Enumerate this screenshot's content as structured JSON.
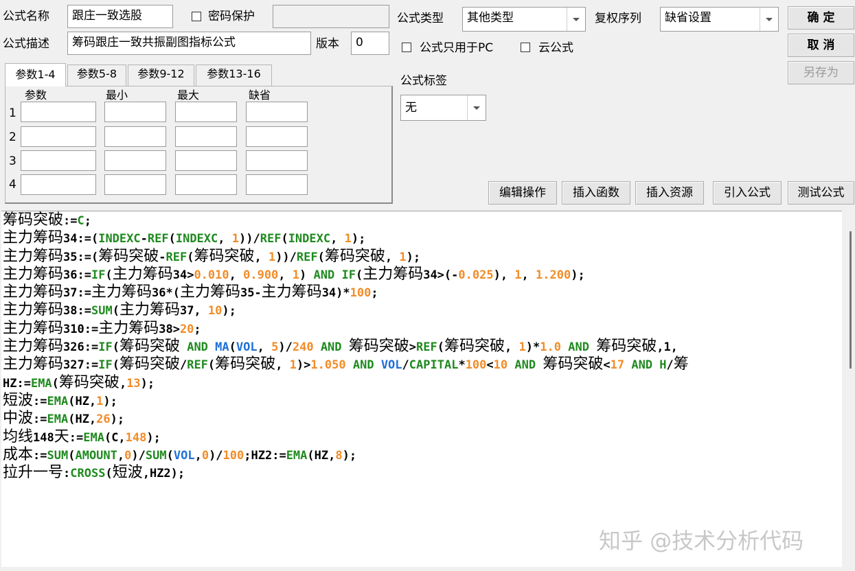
{
  "form": {
    "name_label": "公式名称",
    "name_value": "跟庄一致选股",
    "password_label": "密码保护",
    "password_value": "",
    "desc_label": "公式描述",
    "desc_value": "筹码跟庄一致共振副图指标公式",
    "version_label": "版本",
    "version_value": "0",
    "type_label": "公式类型",
    "type_value": "其他类型",
    "rights_label": "复权序列",
    "rights_value": "缺省设置",
    "pc_only_label": "公式只用于PC",
    "cloud_label": "云公式",
    "tag_label": "公式标签",
    "tag_value": "无"
  },
  "buttons": {
    "ok": "确 定",
    "cancel": "取 消",
    "save_as": "另存为",
    "edit": "编辑操作",
    "insert_func": "插入函数",
    "insert_res": "插入资源",
    "import": "引入公式",
    "test": "测试公式"
  },
  "tabs": [
    "参数1-4",
    "参数5-8",
    "参数9-12",
    "参数13-16"
  ],
  "params": {
    "headers": [
      "参数",
      "最小",
      "最大",
      "缺省"
    ],
    "rows": [
      "1",
      "2",
      "3",
      "4"
    ]
  },
  "code_lines": [
    [
      {
        "c": "t",
        "s": "筹码突破"
      },
      {
        "c": "t",
        "s": ":="
      },
      {
        "c": "k",
        "s": "C"
      },
      {
        "c": "t",
        "s": ";"
      }
    ],
    [
      {
        "c": "t",
        "s": "主力筹码34:=("
      },
      {
        "c": "k",
        "s": "INDEXC"
      },
      {
        "c": "t",
        "s": "-"
      },
      {
        "c": "k",
        "s": "REF"
      },
      {
        "c": "t",
        "s": "("
      },
      {
        "c": "k",
        "s": "INDEXC"
      },
      {
        "c": "t",
        "s": ", "
      },
      {
        "c": "n",
        "s": "1"
      },
      {
        "c": "t",
        "s": "))/"
      },
      {
        "c": "k",
        "s": "REF"
      },
      {
        "c": "t",
        "s": "("
      },
      {
        "c": "k",
        "s": "INDEXC"
      },
      {
        "c": "t",
        "s": ", "
      },
      {
        "c": "n",
        "s": "1"
      },
      {
        "c": "t",
        "s": ");"
      }
    ],
    [
      {
        "c": "t",
        "s": "主力筹码35:=(筹码突破-"
      },
      {
        "c": "k",
        "s": "REF"
      },
      {
        "c": "t",
        "s": "(筹码突破, "
      },
      {
        "c": "n",
        "s": "1"
      },
      {
        "c": "t",
        "s": "))/"
      },
      {
        "c": "k",
        "s": "REF"
      },
      {
        "c": "t",
        "s": "(筹码突破, "
      },
      {
        "c": "n",
        "s": "1"
      },
      {
        "c": "t",
        "s": ");"
      }
    ],
    [
      {
        "c": "t",
        "s": "主力筹码36:="
      },
      {
        "c": "k",
        "s": "IF"
      },
      {
        "c": "t",
        "s": "(主力筹码34>"
      },
      {
        "c": "n",
        "s": "0.010"
      },
      {
        "c": "t",
        "s": ", "
      },
      {
        "c": "n",
        "s": "0.900"
      },
      {
        "c": "t",
        "s": ", "
      },
      {
        "c": "n",
        "s": "1"
      },
      {
        "c": "t",
        "s": ") "
      },
      {
        "c": "k",
        "s": "AND IF"
      },
      {
        "c": "t",
        "s": "(主力筹码34>(-"
      },
      {
        "c": "n",
        "s": "0.025"
      },
      {
        "c": "t",
        "s": "), "
      },
      {
        "c": "n",
        "s": "1"
      },
      {
        "c": "t",
        "s": ", "
      },
      {
        "c": "n",
        "s": "1.200"
      },
      {
        "c": "t",
        "s": ");"
      }
    ],
    [
      {
        "c": "t",
        "s": "主力筹码37:=主力筹码36*(主力筹码35-主力筹码34)*"
      },
      {
        "c": "n",
        "s": "100"
      },
      {
        "c": "t",
        "s": ";"
      }
    ],
    [
      {
        "c": "t",
        "s": "主力筹码38:="
      },
      {
        "c": "k",
        "s": "SUM"
      },
      {
        "c": "t",
        "s": "(主力筹码37, "
      },
      {
        "c": "n",
        "s": "10"
      },
      {
        "c": "t",
        "s": ");"
      }
    ],
    [
      {
        "c": "t",
        "s": "主力筹码310:=主力筹码38>"
      },
      {
        "c": "n",
        "s": "20"
      },
      {
        "c": "t",
        "s": ";"
      }
    ],
    [
      {
        "c": "t",
        "s": "主力筹码326:="
      },
      {
        "c": "k",
        "s": "IF"
      },
      {
        "c": "t",
        "s": "(筹码突破 "
      },
      {
        "c": "k",
        "s": "AND"
      },
      {
        "c": "t",
        "s": " "
      },
      {
        "c": "b",
        "s": "MA"
      },
      {
        "c": "t",
        "s": "("
      },
      {
        "c": "b",
        "s": "VOL"
      },
      {
        "c": "t",
        "s": ", "
      },
      {
        "c": "n",
        "s": "5"
      },
      {
        "c": "t",
        "s": ")/"
      },
      {
        "c": "n",
        "s": "240"
      },
      {
        "c": "t",
        "s": " "
      },
      {
        "c": "k",
        "s": "AND"
      },
      {
        "c": "t",
        "s": " 筹码突破>"
      },
      {
        "c": "k",
        "s": "REF"
      },
      {
        "c": "t",
        "s": "(筹码突破, "
      },
      {
        "c": "n",
        "s": "1"
      },
      {
        "c": "t",
        "s": ")*"
      },
      {
        "c": "n",
        "s": "1.0"
      },
      {
        "c": "t",
        "s": " "
      },
      {
        "c": "k",
        "s": "AND"
      },
      {
        "c": "t",
        "s": " 筹码突破,1,"
      }
    ],
    [
      {
        "c": "t",
        "s": "主力筹码327:="
      },
      {
        "c": "k",
        "s": "IF"
      },
      {
        "c": "t",
        "s": "(筹码突破/"
      },
      {
        "c": "k",
        "s": "REF"
      },
      {
        "c": "t",
        "s": "(筹码突破, "
      },
      {
        "c": "n",
        "s": "1"
      },
      {
        "c": "t",
        "s": ")>"
      },
      {
        "c": "n",
        "s": "1.050"
      },
      {
        "c": "t",
        "s": " "
      },
      {
        "c": "k",
        "s": "AND"
      },
      {
        "c": "t",
        "s": " "
      },
      {
        "c": "b",
        "s": "VOL"
      },
      {
        "c": "t",
        "s": "/"
      },
      {
        "c": "k",
        "s": "CAPITAL"
      },
      {
        "c": "t",
        "s": "*"
      },
      {
        "c": "n",
        "s": "100"
      },
      {
        "c": "t",
        "s": "<"
      },
      {
        "c": "n",
        "s": "10"
      },
      {
        "c": "t",
        "s": " "
      },
      {
        "c": "k",
        "s": "AND"
      },
      {
        "c": "t",
        "s": " 筹码突破<"
      },
      {
        "c": "n",
        "s": "17"
      },
      {
        "c": "t",
        "s": " "
      },
      {
        "c": "k",
        "s": "AND H"
      },
      {
        "c": "t",
        "s": "/筹"
      }
    ],
    [
      {
        "c": "t",
        "s": "HZ:="
      },
      {
        "c": "k",
        "s": "EMA"
      },
      {
        "c": "t",
        "s": "(筹码突破,"
      },
      {
        "c": "n",
        "s": "13"
      },
      {
        "c": "t",
        "s": ");"
      }
    ],
    [
      {
        "c": "t",
        "s": "短波:="
      },
      {
        "c": "k",
        "s": "EMA"
      },
      {
        "c": "t",
        "s": "(HZ,"
      },
      {
        "c": "n",
        "s": "1"
      },
      {
        "c": "t",
        "s": ");"
      }
    ],
    [
      {
        "c": "t",
        "s": "中波:="
      },
      {
        "c": "k",
        "s": "EMA"
      },
      {
        "c": "t",
        "s": "(HZ,"
      },
      {
        "c": "n",
        "s": "26"
      },
      {
        "c": "t",
        "s": ");"
      }
    ],
    [
      {
        "c": "t",
        "s": "均线148天:="
      },
      {
        "c": "k",
        "s": "EMA"
      },
      {
        "c": "t",
        "s": "(C,"
      },
      {
        "c": "n",
        "s": "148"
      },
      {
        "c": "t",
        "s": ");"
      }
    ],
    [
      {
        "c": "t",
        "s": "成本:="
      },
      {
        "c": "k",
        "s": "SUM"
      },
      {
        "c": "t",
        "s": "("
      },
      {
        "c": "k",
        "s": "AMOUNT"
      },
      {
        "c": "t",
        "s": ","
      },
      {
        "c": "n",
        "s": "0"
      },
      {
        "c": "t",
        "s": ")/"
      },
      {
        "c": "k",
        "s": "SUM"
      },
      {
        "c": "t",
        "s": "("
      },
      {
        "c": "b",
        "s": "VOL"
      },
      {
        "c": "t",
        "s": ","
      },
      {
        "c": "n",
        "s": "0"
      },
      {
        "c": "t",
        "s": ")/"
      },
      {
        "c": "n",
        "s": "100"
      },
      {
        "c": "t",
        "s": ";HZ2:="
      },
      {
        "c": "k",
        "s": "EMA"
      },
      {
        "c": "t",
        "s": "(HZ,"
      },
      {
        "c": "n",
        "s": "8"
      },
      {
        "c": "t",
        "s": ");"
      }
    ],
    [
      {
        "c": "t",
        "s": "拉升一号:"
      },
      {
        "c": "k",
        "s": "CROSS"
      },
      {
        "c": "t",
        "s": "(短波,HZ2);"
      }
    ]
  ],
  "watermark": "知乎 @技术分析代码",
  "colors": {
    "keyword": "#1f8a1f",
    "number": "#f28c28",
    "builtin": "#1e6fd9"
  }
}
